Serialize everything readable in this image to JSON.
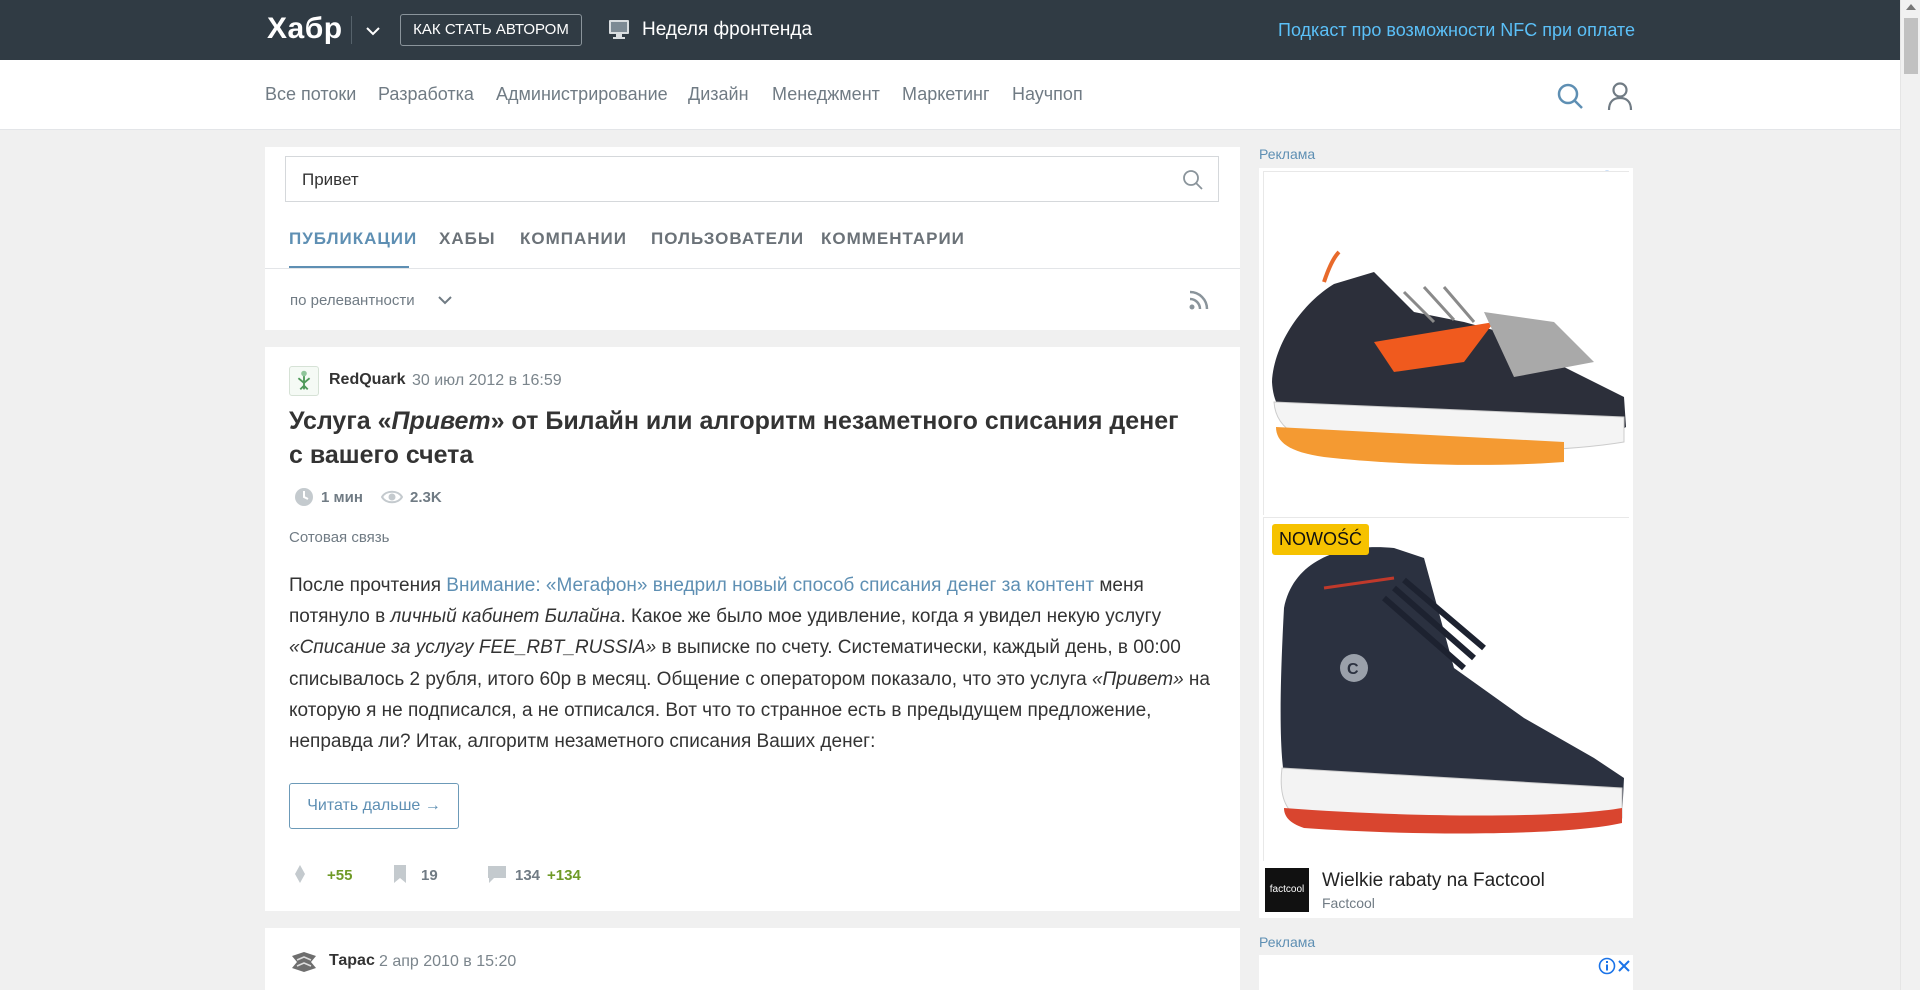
{
  "topbar": {
    "logo": "Хабр",
    "author_button": "КАК СТАТЬ АВТОРОМ",
    "week_link": "Неделя фронтенда",
    "promo_link": "Подкаст про возможности NFC при оплате"
  },
  "nav": {
    "items": [
      "Все потоки",
      "Разработка",
      "Администрирование",
      "Дизайн",
      "Менеджмент",
      "Маркетинг",
      "Научпоп"
    ]
  },
  "search": {
    "query": "Привет",
    "tabs": [
      "ПУБЛИКАЦИИ",
      "ХАБЫ",
      "КОМПАНИИ",
      "ПОЛЬЗОВАТЕЛИ",
      "КОММЕНТАРИИ"
    ],
    "active_tab": "ПУБЛИКАЦИИ",
    "sort": "по релевантности"
  },
  "article": {
    "author": "RedQuark",
    "date": "30 июл 2012 в 16:59",
    "title_before": "Услуга «",
    "title_italic": "Привет",
    "title_after": "» от Билайн или алгоритм незаметного списания денег с вашего счета",
    "reading_time": "1 мин",
    "views": "2.3K",
    "hub": "Сотовая связь",
    "body": {
      "p1": "После прочтения ",
      "link": "Внимание: «Мегафон» внедрил новый способ списания денег за контент",
      "p2": " меня потянуло в ",
      "i1": "личный кабинет Билайна",
      "p3": ". Какое же было мое удивление, когда я увидел некую услугу ",
      "i2": "«Списание за услугу FEE_RBT_RUSSIA»",
      "p4": " в выписке по счету. Систематически, каждый день, в 00:00 списывалось 2 рубля, итого 60р в месяц. Общение с оператором показало, что это услуга ",
      "i3": "«Привет»",
      "p5": " на которую я не подписался, а не отписался. Вот что то странное есть в предыдущем предложение, неправда ли? Итак, алгоритм незаметного списания Ваших денег:"
    },
    "read_more": "Читать дальше →",
    "rating": "+55",
    "bookmarks": "19",
    "comments": "134",
    "new_comments": "+134"
  },
  "article2": {
    "author": "Тарас",
    "date": "2 апр 2010 в 15:20"
  },
  "sidebar": {
    "ad_label": "Реклама",
    "badge": "NOWOŚĆ",
    "ad_title": "Wielkie rabaty na Factcool",
    "ad_brand": "Factcool",
    "ad_logo_text": "factcool",
    "ad_label2": "Реклама"
  },
  "colors": {
    "topbar": "#303b44",
    "accent": "#5e8fb3",
    "promo": "#5bc0f8",
    "positive": "#6f9a27"
  }
}
